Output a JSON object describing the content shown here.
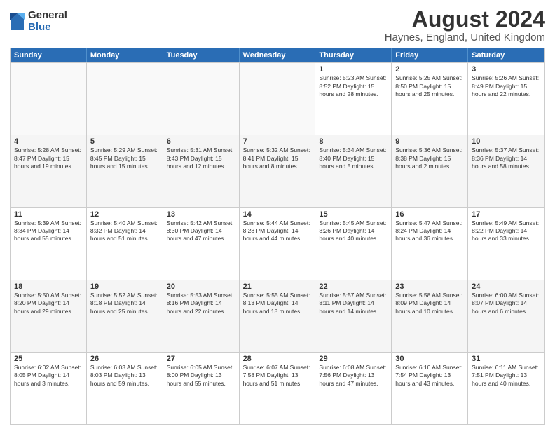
{
  "logo": {
    "general": "General",
    "blue": "Blue"
  },
  "title": "August 2024",
  "subtitle": "Haynes, England, United Kingdom",
  "header_days": [
    "Sunday",
    "Monday",
    "Tuesday",
    "Wednesday",
    "Thursday",
    "Friday",
    "Saturday"
  ],
  "rows": [
    [
      {
        "day": "",
        "text": "",
        "empty": true
      },
      {
        "day": "",
        "text": "",
        "empty": true
      },
      {
        "day": "",
        "text": "",
        "empty": true
      },
      {
        "day": "",
        "text": "",
        "empty": true
      },
      {
        "day": "1",
        "text": "Sunrise: 5:23 AM\nSunset: 8:52 PM\nDaylight: 15 hours\nand 28 minutes."
      },
      {
        "day": "2",
        "text": "Sunrise: 5:25 AM\nSunset: 8:50 PM\nDaylight: 15 hours\nand 25 minutes."
      },
      {
        "day": "3",
        "text": "Sunrise: 5:26 AM\nSunset: 8:49 PM\nDaylight: 15 hours\nand 22 minutes."
      }
    ],
    [
      {
        "day": "4",
        "text": "Sunrise: 5:28 AM\nSunset: 8:47 PM\nDaylight: 15 hours\nand 19 minutes."
      },
      {
        "day": "5",
        "text": "Sunrise: 5:29 AM\nSunset: 8:45 PM\nDaylight: 15 hours\nand 15 minutes."
      },
      {
        "day": "6",
        "text": "Sunrise: 5:31 AM\nSunset: 8:43 PM\nDaylight: 15 hours\nand 12 minutes."
      },
      {
        "day": "7",
        "text": "Sunrise: 5:32 AM\nSunset: 8:41 PM\nDaylight: 15 hours\nand 8 minutes."
      },
      {
        "day": "8",
        "text": "Sunrise: 5:34 AM\nSunset: 8:40 PM\nDaylight: 15 hours\nand 5 minutes."
      },
      {
        "day": "9",
        "text": "Sunrise: 5:36 AM\nSunset: 8:38 PM\nDaylight: 15 hours\nand 2 minutes."
      },
      {
        "day": "10",
        "text": "Sunrise: 5:37 AM\nSunset: 8:36 PM\nDaylight: 14 hours\nand 58 minutes."
      }
    ],
    [
      {
        "day": "11",
        "text": "Sunrise: 5:39 AM\nSunset: 8:34 PM\nDaylight: 14 hours\nand 55 minutes."
      },
      {
        "day": "12",
        "text": "Sunrise: 5:40 AM\nSunset: 8:32 PM\nDaylight: 14 hours\nand 51 minutes."
      },
      {
        "day": "13",
        "text": "Sunrise: 5:42 AM\nSunset: 8:30 PM\nDaylight: 14 hours\nand 47 minutes."
      },
      {
        "day": "14",
        "text": "Sunrise: 5:44 AM\nSunset: 8:28 PM\nDaylight: 14 hours\nand 44 minutes."
      },
      {
        "day": "15",
        "text": "Sunrise: 5:45 AM\nSunset: 8:26 PM\nDaylight: 14 hours\nand 40 minutes."
      },
      {
        "day": "16",
        "text": "Sunrise: 5:47 AM\nSunset: 8:24 PM\nDaylight: 14 hours\nand 36 minutes."
      },
      {
        "day": "17",
        "text": "Sunrise: 5:49 AM\nSunset: 8:22 PM\nDaylight: 14 hours\nand 33 minutes."
      }
    ],
    [
      {
        "day": "18",
        "text": "Sunrise: 5:50 AM\nSunset: 8:20 PM\nDaylight: 14 hours\nand 29 minutes."
      },
      {
        "day": "19",
        "text": "Sunrise: 5:52 AM\nSunset: 8:18 PM\nDaylight: 14 hours\nand 25 minutes."
      },
      {
        "day": "20",
        "text": "Sunrise: 5:53 AM\nSunset: 8:16 PM\nDaylight: 14 hours\nand 22 minutes."
      },
      {
        "day": "21",
        "text": "Sunrise: 5:55 AM\nSunset: 8:13 PM\nDaylight: 14 hours\nand 18 minutes."
      },
      {
        "day": "22",
        "text": "Sunrise: 5:57 AM\nSunset: 8:11 PM\nDaylight: 14 hours\nand 14 minutes."
      },
      {
        "day": "23",
        "text": "Sunrise: 5:58 AM\nSunset: 8:09 PM\nDaylight: 14 hours\nand 10 minutes."
      },
      {
        "day": "24",
        "text": "Sunrise: 6:00 AM\nSunset: 8:07 PM\nDaylight: 14 hours\nand 6 minutes."
      }
    ],
    [
      {
        "day": "25",
        "text": "Sunrise: 6:02 AM\nSunset: 8:05 PM\nDaylight: 14 hours\nand 3 minutes."
      },
      {
        "day": "26",
        "text": "Sunrise: 6:03 AM\nSunset: 8:03 PM\nDaylight: 13 hours\nand 59 minutes."
      },
      {
        "day": "27",
        "text": "Sunrise: 6:05 AM\nSunset: 8:00 PM\nDaylight: 13 hours\nand 55 minutes."
      },
      {
        "day": "28",
        "text": "Sunrise: 6:07 AM\nSunset: 7:58 PM\nDaylight: 13 hours\nand 51 minutes."
      },
      {
        "day": "29",
        "text": "Sunrise: 6:08 AM\nSunset: 7:56 PM\nDaylight: 13 hours\nand 47 minutes."
      },
      {
        "day": "30",
        "text": "Sunrise: 6:10 AM\nSunset: 7:54 PM\nDaylight: 13 hours\nand 43 minutes."
      },
      {
        "day": "31",
        "text": "Sunrise: 6:11 AM\nSunset: 7:51 PM\nDaylight: 13 hours\nand 40 minutes."
      }
    ]
  ]
}
